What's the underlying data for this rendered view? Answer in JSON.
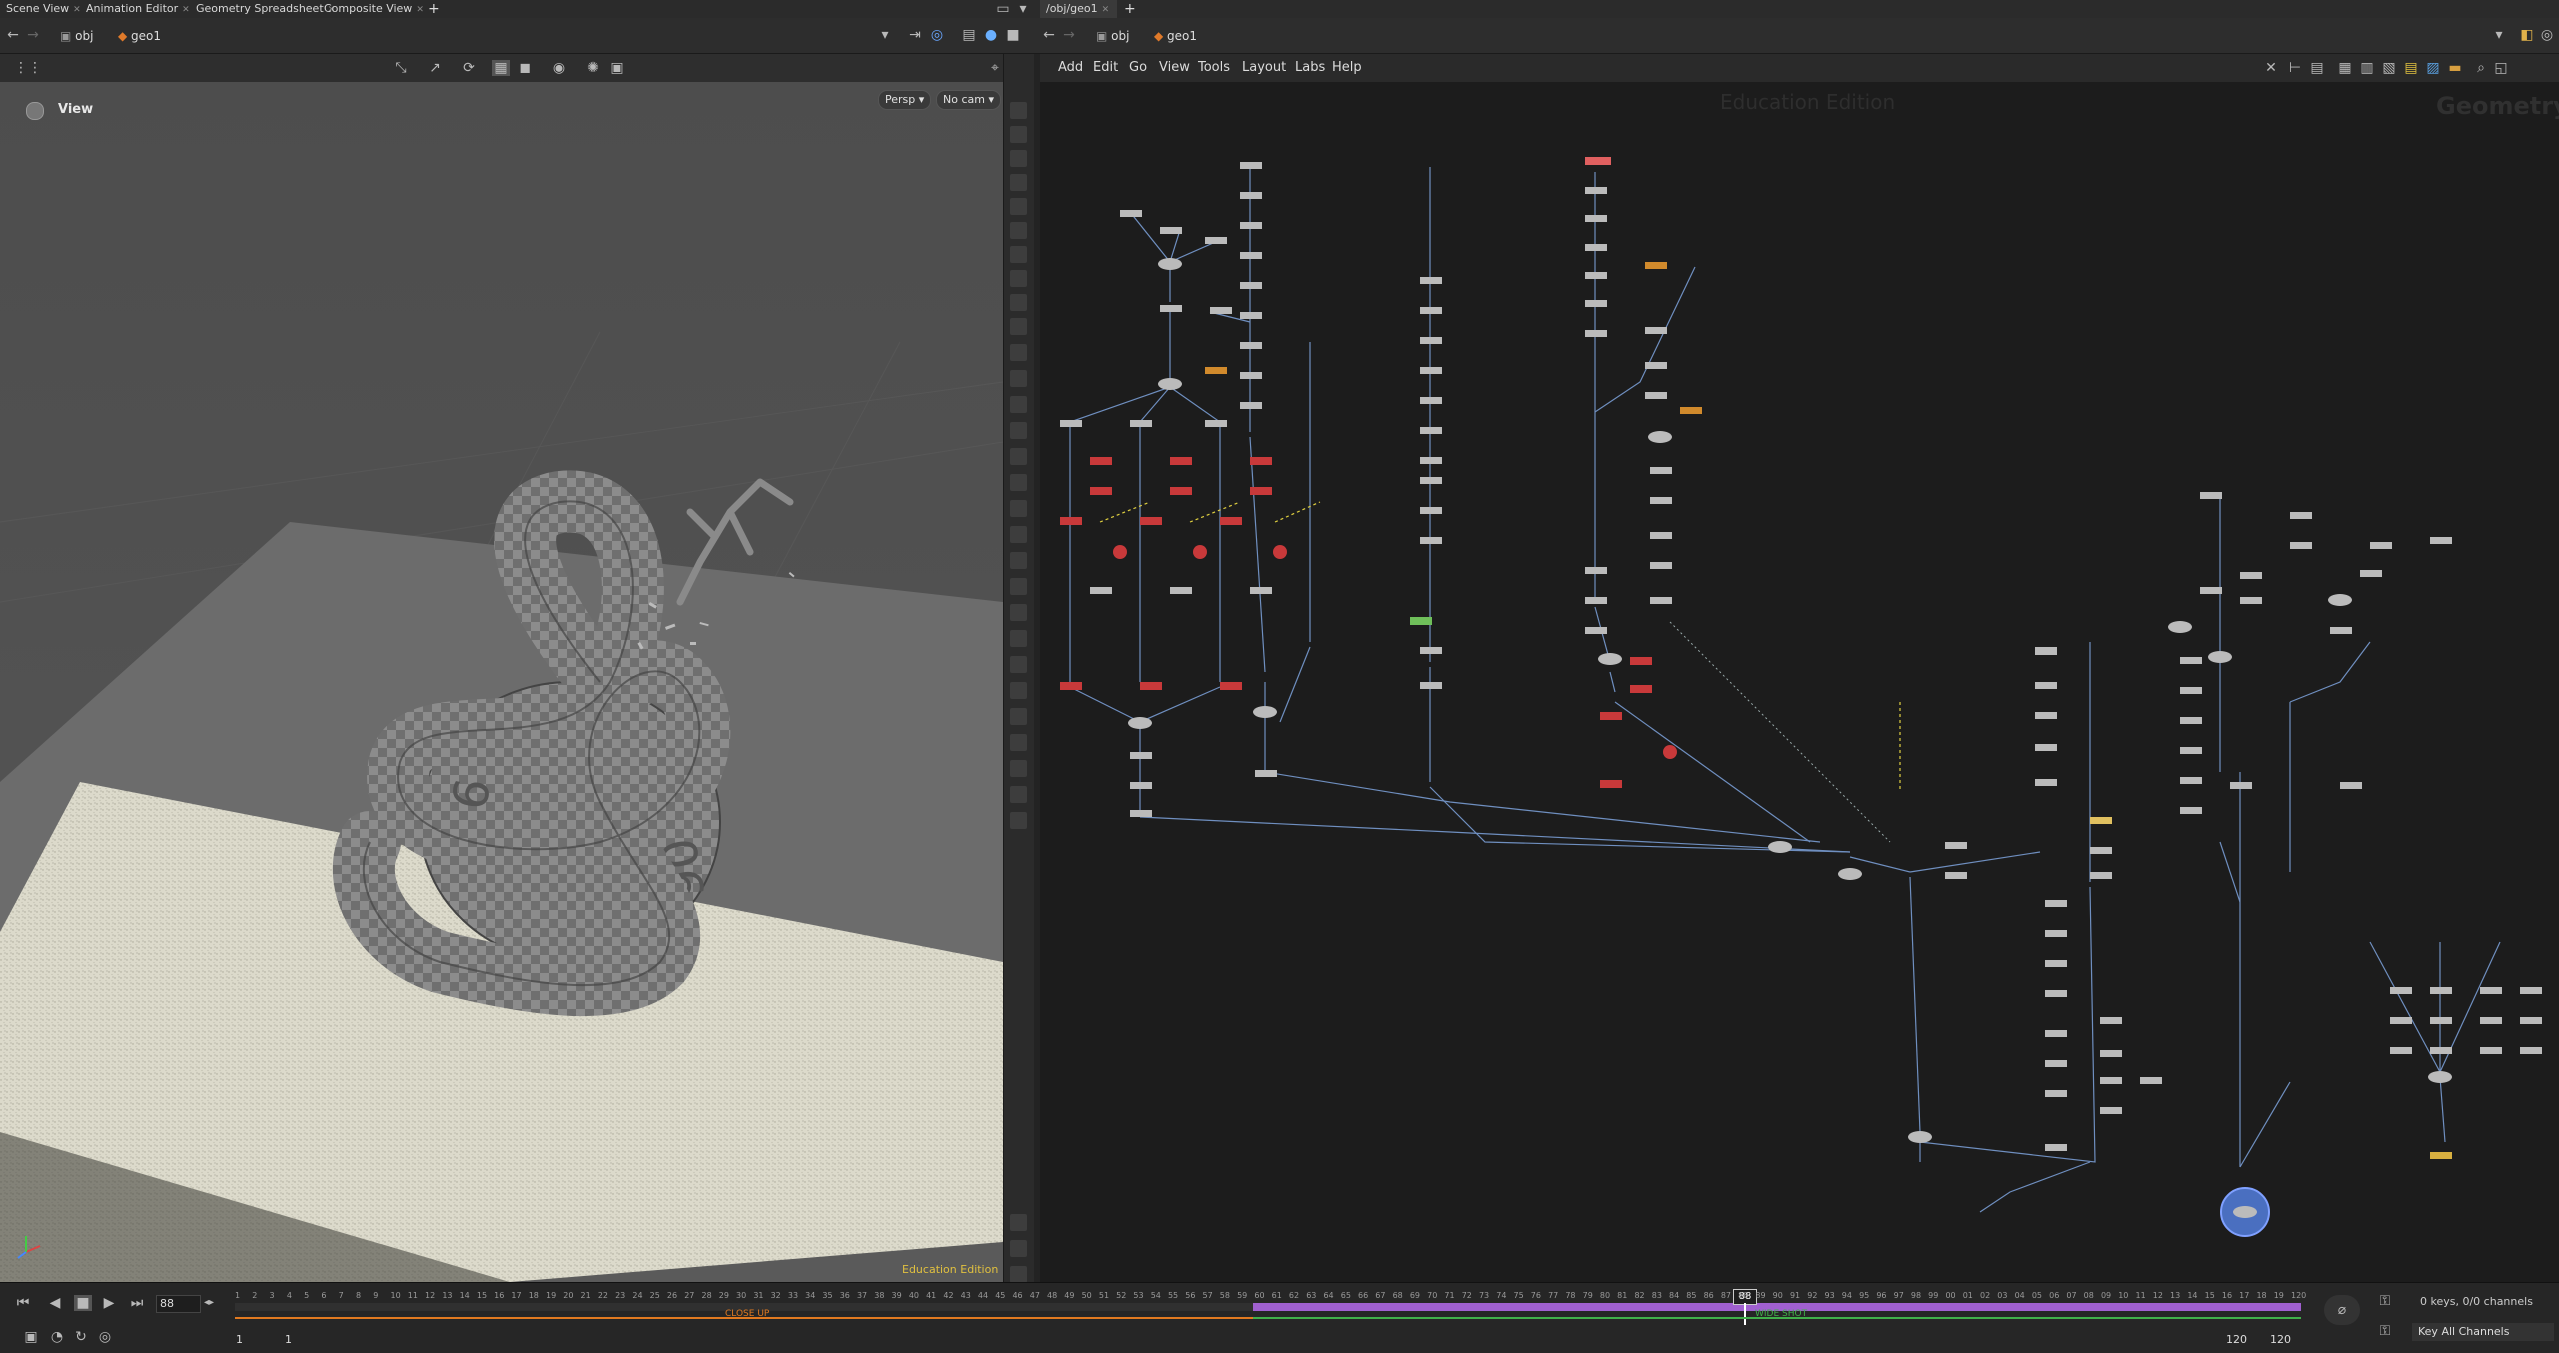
{
  "left_tabs": [
    "Scene View",
    "Animation Editor",
    "Geometry Spreadsheet",
    "Composite View"
  ],
  "right_tabs": [
    "/obj/geo1"
  ],
  "left_path": [
    "obj",
    "geo1"
  ],
  "right_path": [
    "obj",
    "geo1"
  ],
  "viewport": {
    "title": "View",
    "persp_label": "Persp",
    "cam_label": "No cam",
    "edition": "Education Edition"
  },
  "network": {
    "menu": [
      "Add",
      "Edit",
      "Go",
      "View",
      "Tools",
      "Layout",
      "Labs",
      "Help"
    ],
    "watermark": "Education Edition",
    "context_label": "Geometry",
    "annotations": {
      "labels": [
        "CLOSE UP",
        "WIDE SHOT"
      ]
    }
  },
  "timeline": {
    "current_frame": "88",
    "range_start": "1",
    "range_step": "1",
    "range_end_a": "120",
    "range_end_b": "120",
    "keys_status": "0 keys, 0/0 channels",
    "key_channels_btn": "Key All Channels",
    "marker_close": "CLOSE UP",
    "marker_wide": "WIDE SHOT",
    "ticks": [
      "1",
      "2",
      "3",
      "4",
      "5",
      "6",
      "7",
      "8",
      "9",
      "10",
      "11",
      "12",
      "13",
      "14",
      "15",
      "16",
      "17",
      "18",
      "19",
      "20",
      "21",
      "22",
      "23",
      "24",
      "25",
      "26",
      "27",
      "28",
      "29",
      "30",
      "31",
      "32",
      "33",
      "34",
      "35",
      "36",
      "37",
      "38",
      "39",
      "40",
      "41",
      "42",
      "43",
      "44",
      "45",
      "46",
      "47",
      "48",
      "49",
      "50",
      "51",
      "52",
      "53",
      "54",
      "55",
      "56",
      "57",
      "58",
      "59",
      "60",
      "61",
      "62",
      "63",
      "64",
      "65",
      "66",
      "67",
      "68",
      "69",
      "70",
      "71",
      "72",
      "73",
      "74",
      "75",
      "76",
      "77",
      "78",
      "79",
      "80",
      "81",
      "82",
      "83",
      "84",
      "85",
      "86",
      "87",
      "88",
      "89",
      "90",
      "91",
      "92",
      "93",
      "94",
      "95",
      "96",
      "97",
      "98",
      "99",
      "00",
      "01",
      "02",
      "03",
      "04",
      "05",
      "06",
      "07",
      "08",
      "09",
      "10",
      "11",
      "12",
      "13",
      "14",
      "15",
      "16",
      "17",
      "18",
      "19",
      "120"
    ]
  },
  "colors": {
    "bg": "#232323",
    "network_bg": "#1c1c1c",
    "wire": "#6f8fc0",
    "node_red": "#c8393a",
    "node_orange": "#d18a2c",
    "node_green": "#6fbf5a",
    "range_purple": "#a060d0",
    "marker_orange": "#e27a20",
    "marker_green": "#41b04a"
  }
}
